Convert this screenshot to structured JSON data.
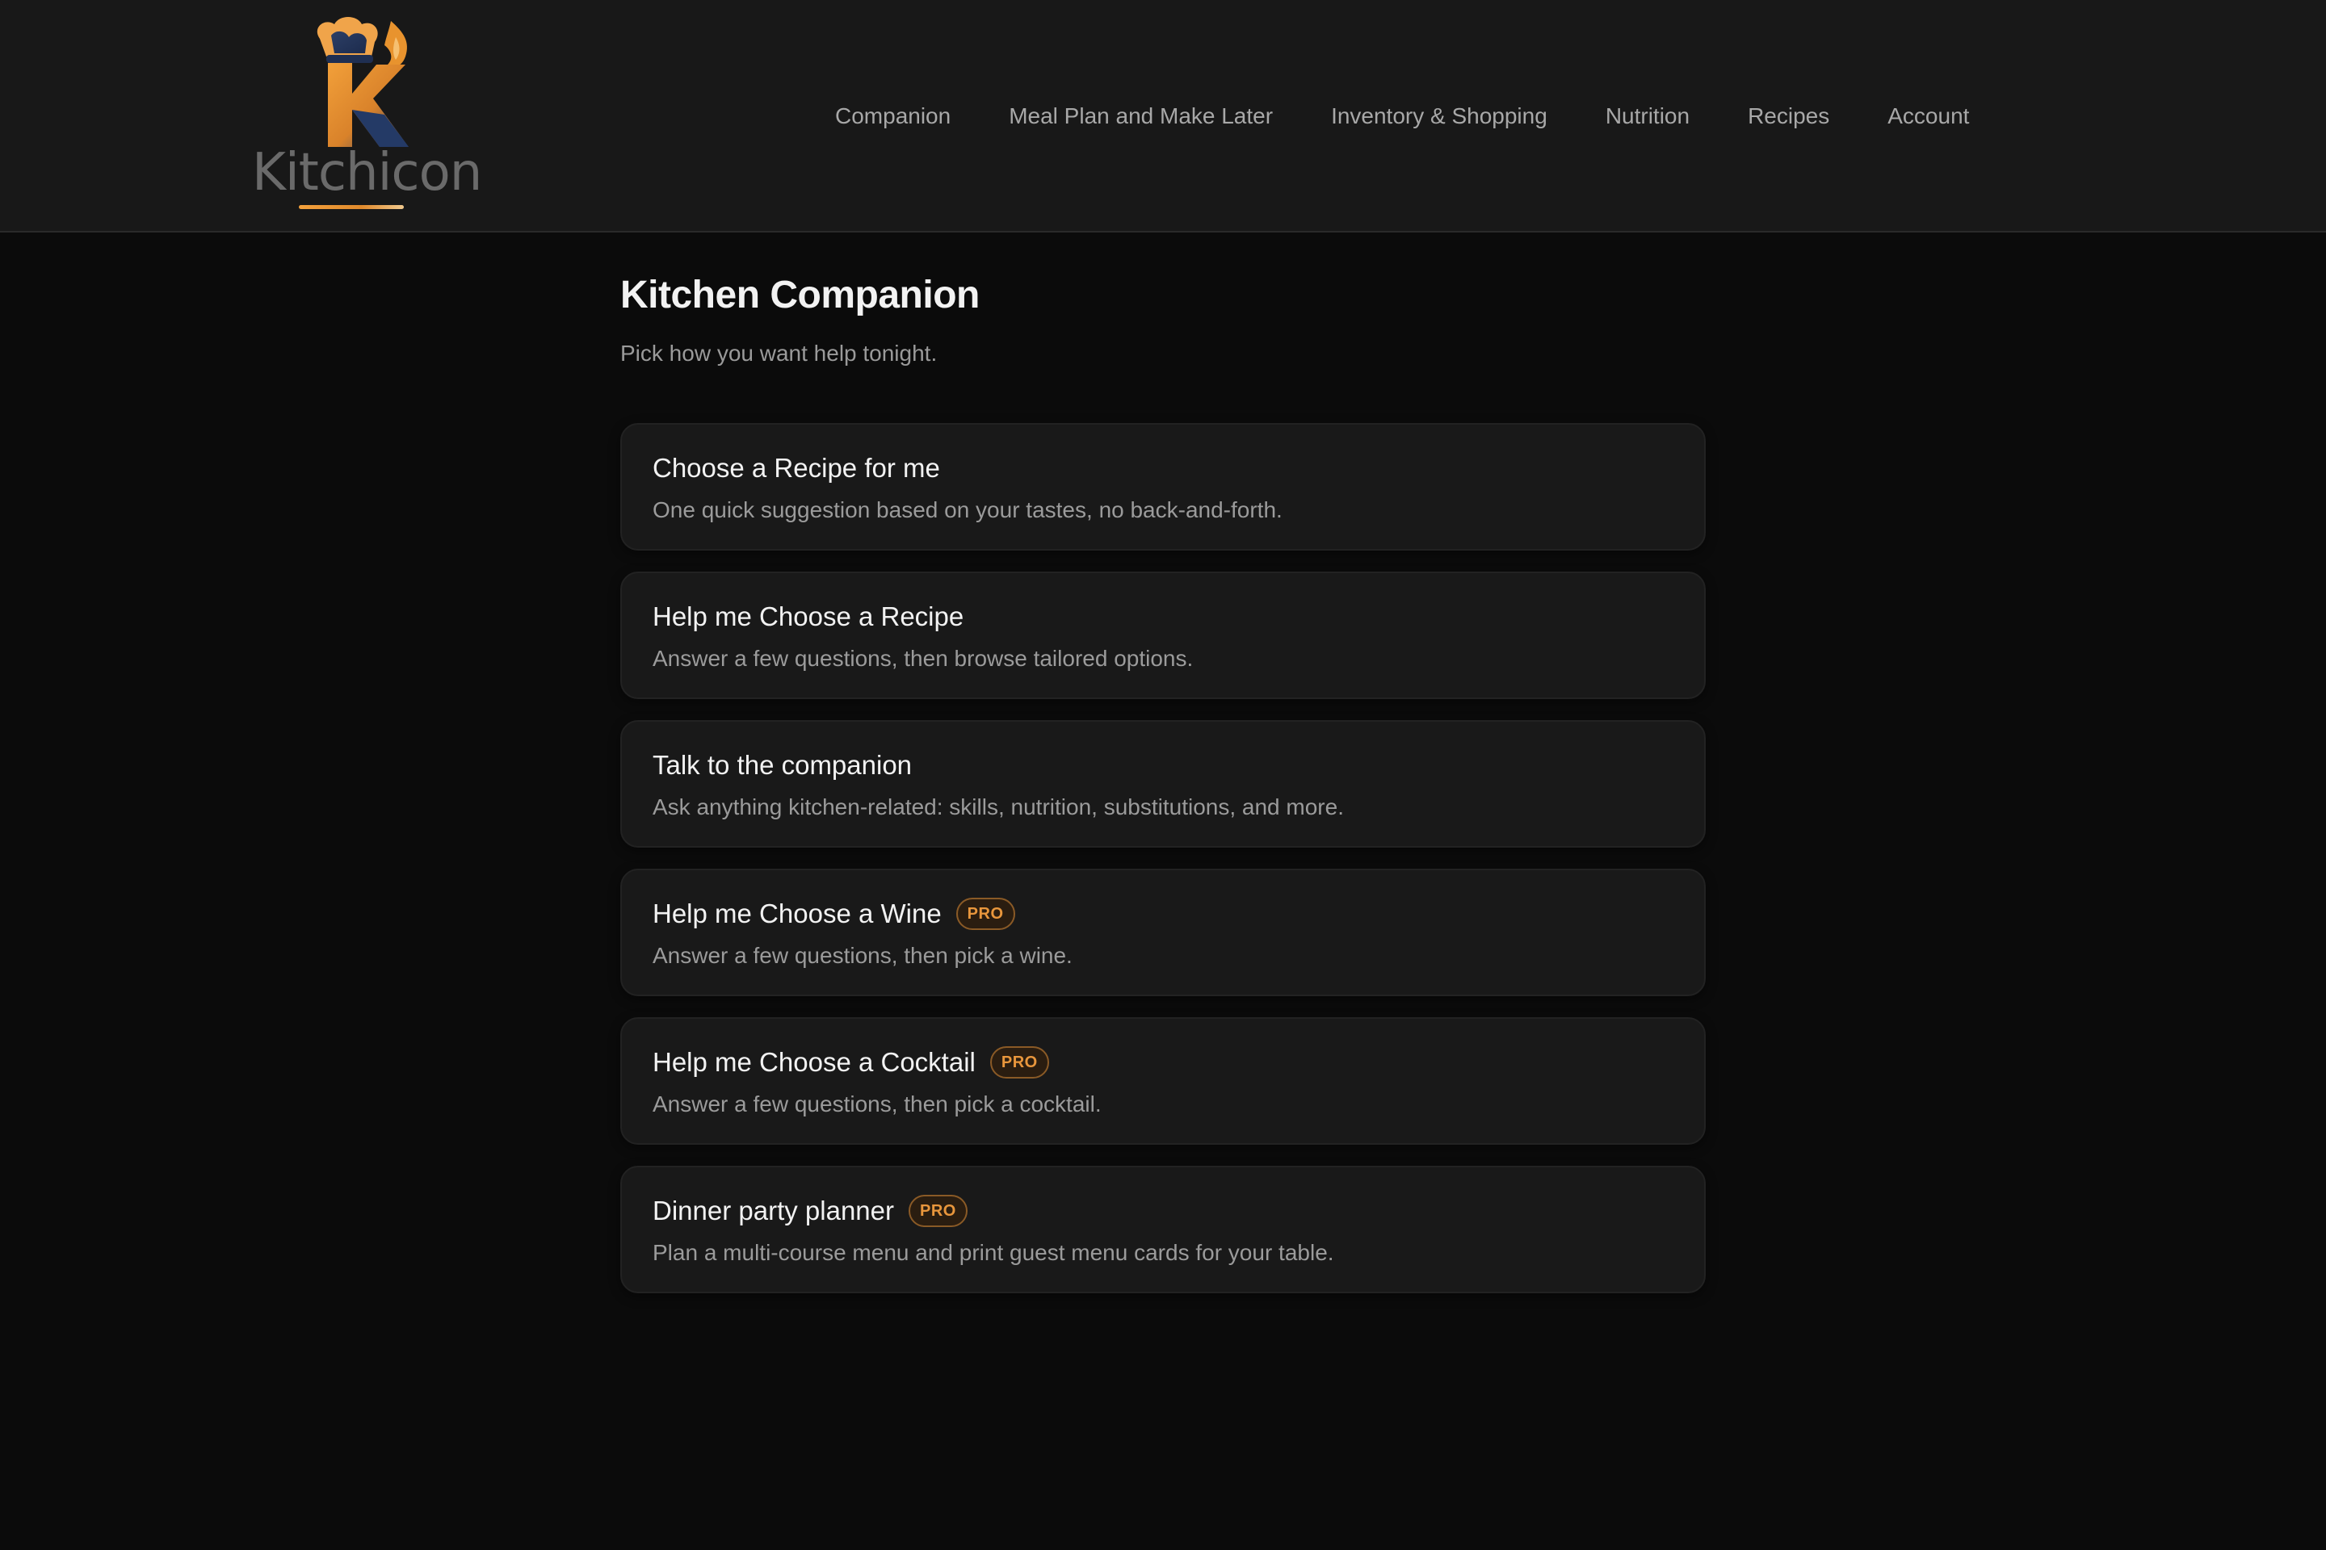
{
  "brand": {
    "name": "Kitchicon",
    "accent": "#e8963c",
    "logo_secondary": "#243a66"
  },
  "nav": {
    "items": [
      {
        "label": "Companion"
      },
      {
        "label": "Meal Plan and Make Later"
      },
      {
        "label": "Inventory & Shopping"
      },
      {
        "label": "Nutrition"
      },
      {
        "label": "Recipes"
      },
      {
        "label": "Account"
      }
    ]
  },
  "page": {
    "title": "Kitchen Companion",
    "subtitle": "Pick how you want help tonight."
  },
  "options": [
    {
      "title": "Choose a Recipe for me",
      "description": "One quick suggestion based on your tastes, no back-and-forth.",
      "badge": ""
    },
    {
      "title": "Help me Choose a Recipe",
      "description": "Answer a few questions, then browse tailored options.",
      "badge": ""
    },
    {
      "title": "Talk to the companion",
      "description": "Ask anything kitchen-related: skills, nutrition, substitutions, and more.",
      "badge": ""
    },
    {
      "title": "Help me Choose a Wine",
      "description": "Answer a few questions, then pick a wine.",
      "badge": "PRO"
    },
    {
      "title": "Help me Choose a Cocktail",
      "description": "Answer a few questions, then pick a cocktail.",
      "badge": "PRO"
    },
    {
      "title": "Dinner party planner",
      "description": "Plan a multi-course menu and print guest menu cards for your table.",
      "badge": "PRO"
    }
  ]
}
